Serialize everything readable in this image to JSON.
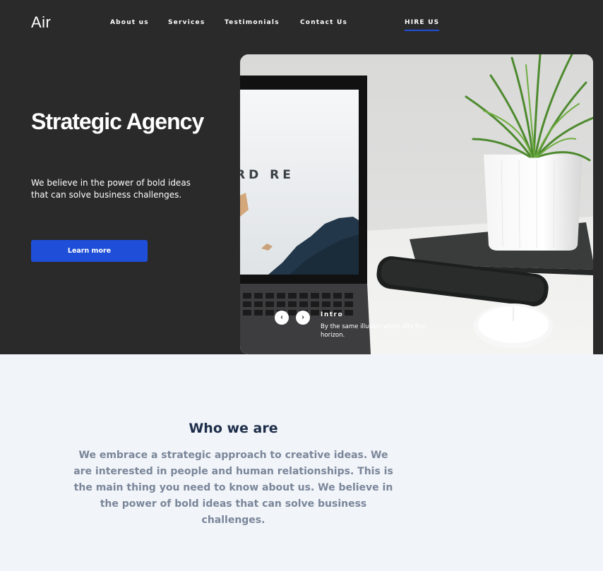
{
  "nav": {
    "logo": "Air",
    "links": [
      "About us",
      "Services",
      "Testimonials",
      "Contact Us"
    ],
    "hire_label": "HIRE US"
  },
  "hero": {
    "title": "Strategic Agency",
    "subtitle": "We believe in the power of bold ideas that can solve business challenges.",
    "cta_label": "Learn more"
  },
  "slide": {
    "screen_text": "RD RE",
    "caption_title": "Intro",
    "caption_text": "By the same illusion which lifts the horizon.",
    "prev_icon": "chevron-left-icon",
    "next_icon": "chevron-right-icon"
  },
  "who": {
    "title": "Who we are",
    "text": "We embrace a strategic approach to creative ideas. We are interested in people and human relationships. This is the main thing you need to know about us. We believe in the power of bold ideas that can solve business challenges."
  },
  "colors": {
    "hero_bg": "#2a2a2a",
    "accent": "#1f4fd8",
    "section_bg": "#f1f4f9",
    "heading": "#1e2e4a",
    "body_text": "#7a8699"
  }
}
